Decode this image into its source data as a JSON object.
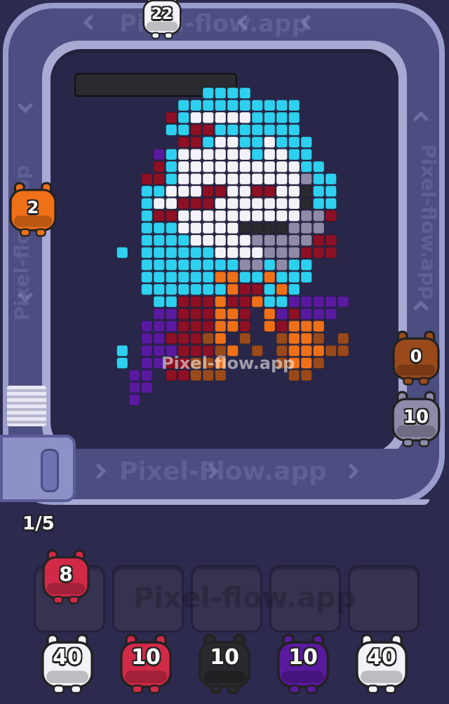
{
  "watermark": "Pixel-flow.app",
  "conveyor_watermark": "Pixel-Flow.app",
  "queue_progress": "1/5",
  "colors": {
    "background": "#2c2a4e",
    "board": "#292749",
    "track": "#4a4c80",
    "cyan": "#2ed0ef",
    "white": "#f2f2f8",
    "dark_red": "#8e1024",
    "pink_red": "#d02a48",
    "purple": "#5a1aa0",
    "orange": "#f07018",
    "brown": "#9a4a1a",
    "gray": "#8e8aa8",
    "black": "#2a2a2e"
  },
  "characters_on_track": [
    {
      "name": "white-shooter-top",
      "count": "22",
      "color": "white"
    },
    {
      "name": "orange-shooter-left",
      "count": "2",
      "color": "orange"
    },
    {
      "name": "brown-shooter-right",
      "count": "0",
      "color": "brown"
    },
    {
      "name": "gray-shooter-right",
      "count": "10",
      "color": "gray"
    }
  ],
  "waiting_character": {
    "count": "8",
    "color": "pink_red"
  },
  "empty_slots": 5,
  "queue": [
    {
      "count": "40",
      "color": "white"
    },
    {
      "count": "10",
      "color": "pink_red"
    },
    {
      "count": "10",
      "color": "black"
    },
    {
      "count": "10",
      "color": "purple"
    },
    {
      "count": "40",
      "color": "white"
    }
  ],
  "pixel_art_rows": [
    "........cccc..........",
    "......cccccccccc......",
    ".....rcwwwwwcccc......",
    ".....ccrrccccccc......",
    "......rrcwwccwccc.....",
    "....pcwwwwwwcwwcc.....",
    "....rcwwwwwwwwwwcc....",
    "...rrcwwwwwwwwwwgcc...",
    "...ccwwwrrwwrrwwkcc...",
    "...cwwrrrwwwwwwwkcc...",
    "...crrwwwwwwwwwwggr...",
    "...cccwwwwwkkkkggg....",
    "...ccccwwwwwgggggrr...",
    ".c.ccccccwwwwgggrrr...",
    "...ccccccccggcgcc.....",
    "...ccccccooccoccc.....",
    "...cccccccorrcoc......",
    "....ccrrrorroccppppp..",
    "....pprrroor.oprppp...",
    "...ppprrroor.orooo....",
    "...pprrrbo.b..boob.b..",
    ".c.ppprrrbo.b.booobb..",
    ".c.pprrbbo....boob....",
    "..pp.rrbbb.....bb.....",
    "..pp...................",
    "..p......................"
  ]
}
